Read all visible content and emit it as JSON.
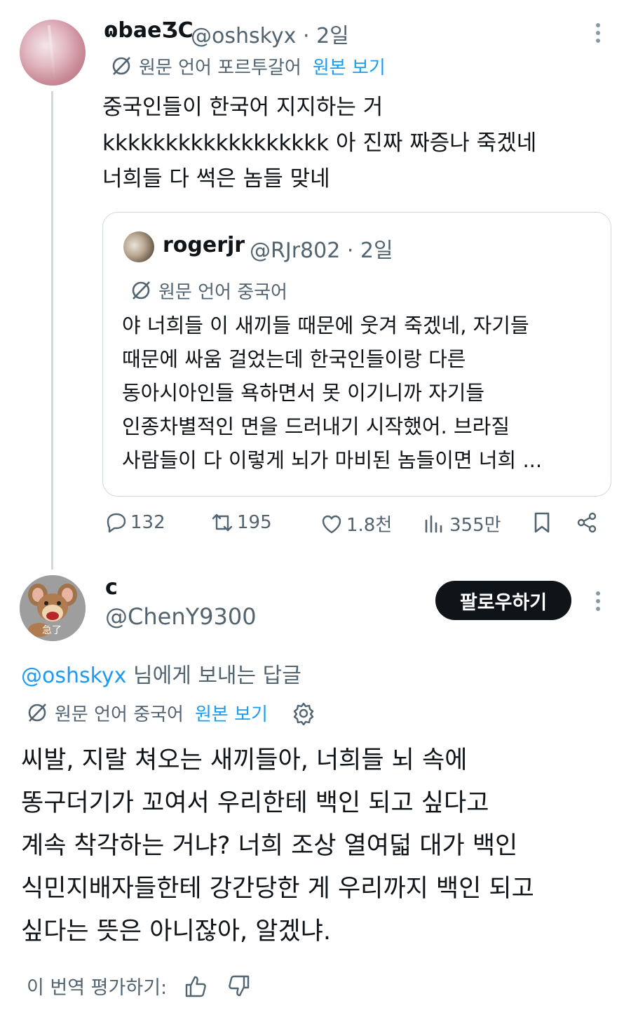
{
  "tweet": {
    "display_name": "ɷbaeƷС",
    "handle": "@oshskyx",
    "time": "· 2일",
    "translation": {
      "label": "원문 언어 포르투갈어",
      "show_original": "원본 보기"
    },
    "text_lines": [
      "중국인들이 한국어 지지하는 거",
      "kkkkkkkkkkkkkkkkkk 아 진짜 짜증나 죽겠네",
      "너희들 다 썩은 놈들 맞네"
    ],
    "quote": {
      "display_name": "rogerjr",
      "handle": "@RJr802",
      "time": "· 2일",
      "translation_label": "원문 언어 중국어",
      "text_lines": [
        "야 너희들 이 새끼들 때문에 웃겨 죽겠네, 자기들",
        "때문에 싸움 걸었는데 한국인들이랑 다른",
        "동아시아인들 욕하면서 못 이기니까 자기들",
        "인종차별적인 면을 드러내기 시작했어. 브라질",
        "사람들이 다 이렇게 뇌가 마비된 놈들이면 너희 ..."
      ]
    },
    "actions": {
      "replies": "132",
      "retweets": "195",
      "likes": "1.8천",
      "views": "355만"
    }
  },
  "reply": {
    "display_name": "c",
    "handle": "@ChenY9300",
    "follow_label": "팔로우하기",
    "avatar_text": "急了",
    "reply_to_mention": "@oshskyx",
    "reply_to_suffix": " 님에게 보내는 답글",
    "translation": {
      "label": "원문 언어 중국어",
      "show_original": "원본 보기"
    },
    "text_lines": [
      "씨발, 지랄 쳐오는 새끼들아, 너희들 뇌 속에",
      "똥구더기가 꼬여서 우리한테 백인 되고 싶다고",
      "계속 착각하는 거냐? 너희 조상 열여덟 대가 백인",
      "식민지배자들한테 강간당한 게 우리까지 백인 되고",
      "싶다는 뜻은 아니잖아, 알겠냐."
    ],
    "rate_label": "이 번역 평가하기:"
  },
  "colors": {
    "text": "#0f1419",
    "secondary": "#536471",
    "link": "#1d9bf0",
    "border": "#cfd9de",
    "button_bg": "#0f1419"
  }
}
